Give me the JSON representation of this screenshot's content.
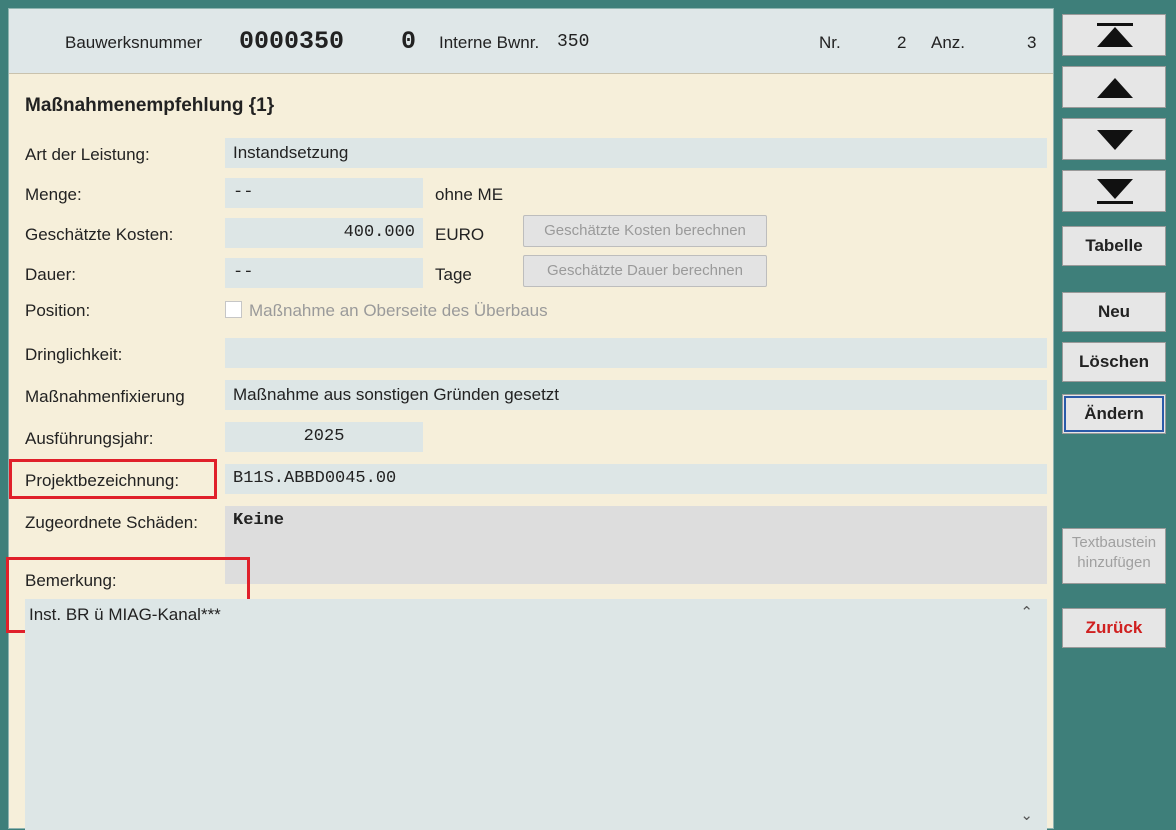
{
  "header": {
    "bauwerksnummer_label": "Bauwerksnummer",
    "bauwerksnummer_value": "0000350",
    "teilbauwerk": "0",
    "interne_label": "Interne Bwnr.",
    "interne_value": "350",
    "nr_label": "Nr.",
    "nr_value": "2",
    "anz_label": "Anz.",
    "anz_value": "3"
  },
  "section_title": "Maßnahmenempfehlung {1}",
  "fields": {
    "art_label": "Art der Leistung:",
    "art_value": "Instandsetzung",
    "menge_label": "Menge:",
    "menge_value": "--",
    "menge_unit": "ohne ME",
    "kosten_label": "Geschätzte Kosten:",
    "kosten_value": "400.000",
    "kosten_unit": "EURO",
    "kosten_button": "Geschätzte Kosten berechnen",
    "dauer_label": "Dauer:",
    "dauer_value": "--",
    "dauer_unit": "Tage",
    "dauer_button": "Geschätzte Dauer berechnen",
    "position_label": "Position:",
    "position_checkbox": "Maßnahme an Oberseite des Überbaus",
    "dringlichkeit_label": "Dringlichkeit:",
    "dringlichkeit_value": "",
    "fixierung_label": "Maßnahmenfixierung",
    "fixierung_value": "Maßnahme aus sonstigen Gründen gesetzt",
    "jahr_label": "Ausführungsjahr:",
    "jahr_value": "2025",
    "projekt_label": "Projektbezeichnung:",
    "projekt_value": "B11S.ABBD0045.00",
    "schaeden_label": "Zugeordnete Schäden:",
    "schaeden_value": "Keine",
    "bemerkung_label": "Bemerkung:",
    "bemerkung_value": "Inst. BR ü MIAG-Kanal***"
  },
  "sidebar": {
    "tabelle": "Tabelle",
    "neu": "Neu",
    "loeschen": "Löschen",
    "aendern": "Ändern",
    "textbaustein_line1": "Textbaustein",
    "textbaustein_line2": "hinzufügen",
    "zurueck": "Zurück"
  },
  "icons": {
    "first": "first-record-icon",
    "prev": "previous-record-icon",
    "next": "next-record-icon",
    "last": "last-record-icon"
  },
  "colors": {
    "accent_red": "#e0202a",
    "background_teal": "#3e7f7a",
    "panel": "#f6efda"
  }
}
